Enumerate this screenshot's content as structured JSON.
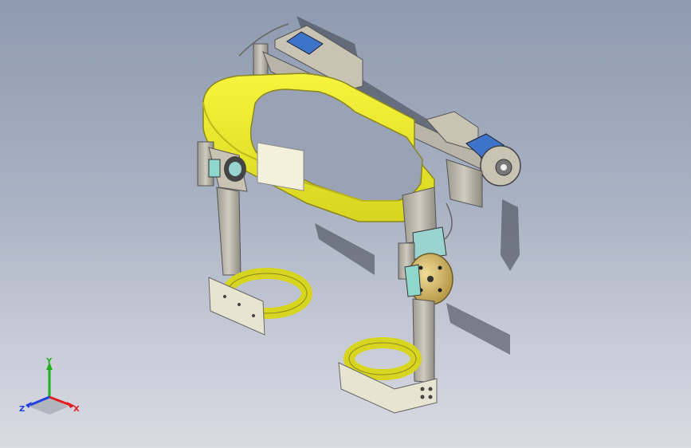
{
  "viewport": {
    "background_top": "#8e9ab0",
    "background_bottom": "#d9dbe2"
  },
  "model": {
    "parts": [
      "waist-belt",
      "hip-actuator-left",
      "hip-actuator-right",
      "hip-joint-left",
      "hip-joint-right",
      "thigh-link-left",
      "thigh-link-right",
      "thigh-cuff-left",
      "thigh-cuff-right",
      "thigh-brace-left",
      "thigh-brace-right"
    ],
    "colors": {
      "belt": "#f2f02a",
      "belt_shade": "#c9c61a",
      "metal": "#b8b4a8",
      "metal_dark": "#7d7a70",
      "motor_blue": "#3d74c9",
      "motor_gray": "#c8c3b3",
      "disc": "#d8c27a",
      "brace": "#e8e4d2"
    }
  },
  "triad": {
    "x_label": "X",
    "y_label": "Y",
    "z_label": "Z",
    "x_color": "#e02020",
    "y_color": "#20b020",
    "z_color": "#2040e0"
  }
}
